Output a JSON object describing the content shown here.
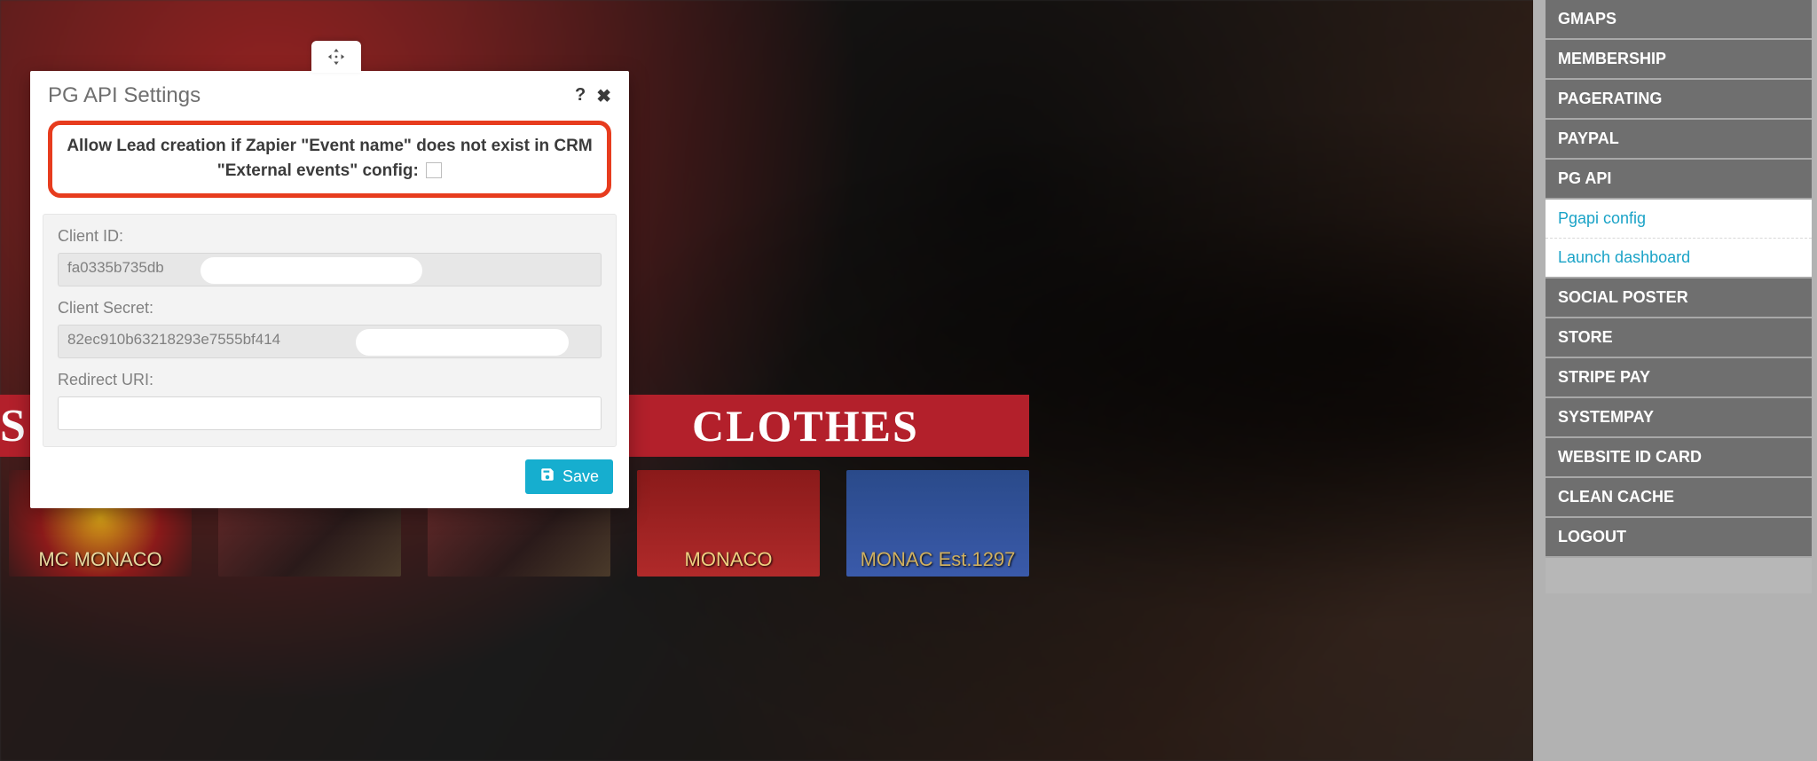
{
  "background": {
    "left_banner_letter": "S",
    "banner_text": "CLOTHES",
    "thumb_badge": "MC MONACO",
    "thumb2": "",
    "thumb3": "",
    "thumb4": "MONACO",
    "thumb5": "MONAC Est.1297"
  },
  "modal": {
    "title": "PG API Settings",
    "highlight_text": "Allow Lead creation if Zapier \"Event name\" does not exist in CRM \"External events\" config:",
    "client_id_label": "Client ID:",
    "client_id_value": "fa0335b735db",
    "client_secret_label": "Client Secret:",
    "client_secret_value": "82ec910b63218293e7555bf414",
    "redirect_uri_label": "Redirect URI:",
    "redirect_uri_value": "",
    "save_label": "Save"
  },
  "sidebar": {
    "items": [
      "GMAPS",
      "MEMBERSHIP",
      "PAGERATING",
      "PAYPAL",
      "PG API"
    ],
    "subitems": [
      "Pgapi config",
      "Launch dashboard"
    ],
    "items2": [
      "SOCIAL POSTER",
      "STORE",
      "STRIPE PAY",
      "SYSTEMPAY",
      "WEBSITE ID CARD",
      "CLEAN CACHE",
      "LOGOUT"
    ]
  }
}
